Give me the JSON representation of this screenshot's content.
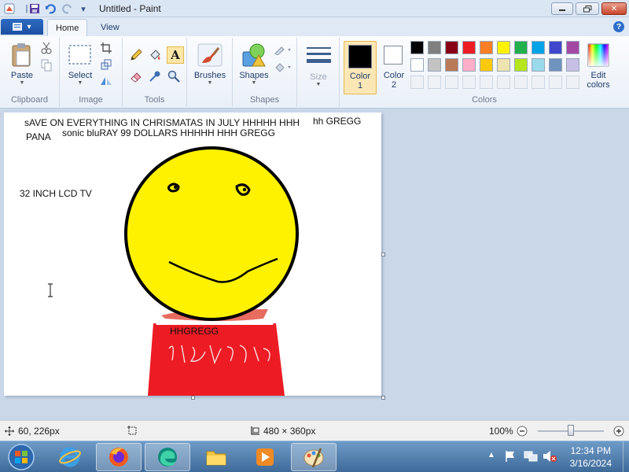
{
  "window": {
    "title": "Untitled - Paint"
  },
  "tabs": {
    "home": "Home",
    "view": "View"
  },
  "ribbon": {
    "clipboard": {
      "paste": "Paste",
      "group": "Clipboard"
    },
    "image": {
      "select": "Select",
      "group": "Image"
    },
    "tools": {
      "group": "Tools"
    },
    "brushes": {
      "label": "Brushes"
    },
    "shapes": {
      "label": "Shapes",
      "group": "Shapes"
    },
    "size": {
      "label": "Size"
    },
    "colors": {
      "color1": "Color",
      "color1_num": "1",
      "color2": "Color",
      "color2_num": "2",
      "edit_top": "Edit",
      "edit_bottom": "colors",
      "group": "Colors",
      "color1_value": "#000000",
      "color2_value": "#ffffff",
      "palette_row1": [
        "#000000",
        "#7f7f7f",
        "#880015",
        "#ed1c24",
        "#ff7f27",
        "#fff200",
        "#22b14c",
        "#00a2e8",
        "#3f48cc",
        "#a349a4"
      ],
      "palette_row2": [
        "#ffffff",
        "#c3c3c3",
        "#b97a57",
        "#ffaec9",
        "#ffc90e",
        "#efe4b0",
        "#b5e61d",
        "#99d9ea",
        "#7092be",
        "#c8bfe7"
      ]
    }
  },
  "canvas": {
    "line1": "sAVE ON EVERYTHING IN CHRISMATAS IN JULY HHHHH HHH",
    "line1b": "hh GREGG",
    "line2a": "PANA",
    "line2b": "sonic bluRAY 99 DOLLARS  HHHHH HHH GREGG",
    "tv": "32 INCH LCD TV",
    "shirt": "HHGREGG",
    "face_color": "#fff200",
    "shirt_color": "#ed1c24"
  },
  "status": {
    "cursor": "60, 226px",
    "size": "480 × 360px",
    "zoom": "100%",
    "zoom_level": 1.0
  },
  "taskbar": {
    "time": "12:34 PM",
    "date": "3/16/2024"
  }
}
